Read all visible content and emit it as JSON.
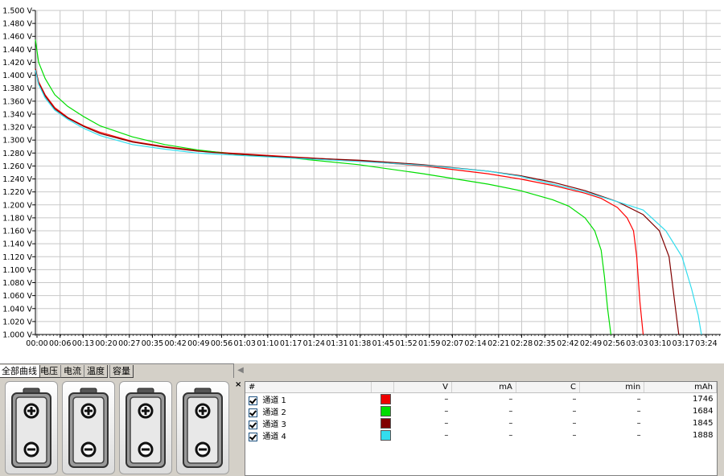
{
  "chart_data": {
    "type": "line",
    "y_unit": "V",
    "ylim": [
      1.0,
      1.5
    ],
    "y_ticks": [
      "1.500 V",
      "1.480 V",
      "1.460 V",
      "1.440 V",
      "1.420 V",
      "1.400 V",
      "1.380 V",
      "1.360 V",
      "1.340 V",
      "1.320 V",
      "1.300 V",
      "1.280 V",
      "1.260 V",
      "1.240 V",
      "1.220 V",
      "1.200 V",
      "1.180 V",
      "1.160 V",
      "1.140 V",
      "1.120 V",
      "1.100 V",
      "1.080 V",
      "1.060 V",
      "1.040 V",
      "1.020 V",
      "1.000 V"
    ],
    "x_ticks": [
      "00:00",
      "00:06",
      "00:13",
      "00:20",
      "00:27",
      "00:35",
      "00:42",
      "00:49",
      "00:56",
      "01:03",
      "01:10",
      "01:17",
      "01:24",
      "01:31",
      "01:38",
      "01:45",
      "01:52",
      "01:59",
      "02:07",
      "02:14",
      "02:21",
      "02:28",
      "02:35",
      "02:42",
      "02:49",
      "02:56",
      "03:03",
      "03:10",
      "03:17",
      "03:24"
    ],
    "x_unit": "minutes",
    "xlim": [
      0,
      212
    ],
    "grid": true,
    "series": [
      {
        "name": "通道 1",
        "color": "#ff0000",
        "x": [
          0,
          1,
          3,
          6,
          10,
          15,
          20,
          30,
          40,
          50,
          60,
          80,
          100,
          120,
          140,
          150,
          160,
          170,
          175,
          180,
          183,
          185,
          186,
          187,
          188
        ],
        "y": [
          1.41,
          1.39,
          1.37,
          1.35,
          1.335,
          1.322,
          1.312,
          1.298,
          1.29,
          1.284,
          1.28,
          1.274,
          1.268,
          1.26,
          1.248,
          1.24,
          1.23,
          1.218,
          1.21,
          1.196,
          1.18,
          1.16,
          1.12,
          1.05,
          1.0
        ]
      },
      {
        "name": "通道 2",
        "color": "#00dd00",
        "x": [
          0,
          1,
          3,
          6,
          10,
          15,
          20,
          30,
          40,
          50,
          60,
          80,
          100,
          120,
          140,
          150,
          160,
          165,
          170,
          173,
          175,
          176,
          177,
          178
        ],
        "y": [
          1.455,
          1.42,
          1.395,
          1.37,
          1.352,
          1.336,
          1.322,
          1.305,
          1.293,
          1.285,
          1.279,
          1.272,
          1.262,
          1.248,
          1.232,
          1.222,
          1.208,
          1.198,
          1.18,
          1.16,
          1.13,
          1.09,
          1.04,
          1.0
        ]
      },
      {
        "name": "通道 3",
        "color": "#800000",
        "x": [
          0,
          1,
          3,
          6,
          10,
          15,
          20,
          30,
          40,
          50,
          60,
          80,
          100,
          120,
          140,
          150,
          160,
          170,
          180,
          188,
          193,
          196,
          197,
          198,
          199
        ],
        "y": [
          1.41,
          1.388,
          1.368,
          1.348,
          1.334,
          1.321,
          1.31,
          1.297,
          1.289,
          1.283,
          1.279,
          1.273,
          1.269,
          1.262,
          1.252,
          1.245,
          1.235,
          1.222,
          1.205,
          1.185,
          1.16,
          1.12,
          1.08,
          1.04,
          1.0
        ]
      },
      {
        "name": "通道 4",
        "color": "#33ddee",
        "x": [
          0,
          1,
          3,
          6,
          10,
          15,
          20,
          30,
          40,
          50,
          60,
          80,
          100,
          120,
          140,
          150,
          160,
          170,
          180,
          188,
          195,
          200,
          203,
          205,
          206
        ],
        "y": [
          1.408,
          1.386,
          1.365,
          1.346,
          1.332,
          1.318,
          1.307,
          1.293,
          1.286,
          1.28,
          1.277,
          1.272,
          1.267,
          1.261,
          1.252,
          1.244,
          1.232,
          1.22,
          1.205,
          1.192,
          1.16,
          1.12,
          1.07,
          1.03,
          1.0
        ]
      }
    ]
  },
  "tabs": [
    {
      "label": "全部曲线",
      "active": true
    },
    {
      "label": "电压",
      "active": false
    },
    {
      "label": "电流",
      "active": false
    },
    {
      "label": "温度",
      "active": false
    },
    {
      "label": "容量",
      "active": false
    }
  ],
  "scroll_left_glyph": "◀",
  "close_glyph": "×",
  "batteries": [
    {
      "icon": "battery-icon"
    },
    {
      "icon": "battery-icon"
    },
    {
      "icon": "battery-icon"
    },
    {
      "icon": "battery-icon"
    }
  ],
  "table": {
    "headers": [
      "#",
      "",
      "V",
      "mA",
      "C",
      "min",
      "mAh"
    ],
    "rows": [
      {
        "name": "通道  1",
        "color": "#ee0000",
        "V": "–",
        "mA": "–",
        "C": "–",
        "min": "–",
        "mAh": "1746"
      },
      {
        "name": "通道  2",
        "color": "#00dd00",
        "V": "–",
        "mA": "–",
        "C": "–",
        "min": "–",
        "mAh": "1684"
      },
      {
        "name": "通道  3",
        "color": "#800000",
        "V": "–",
        "mA": "–",
        "C": "–",
        "min": "–",
        "mAh": "1845"
      },
      {
        "name": "通道  4",
        "color": "#33ddee",
        "V": "–",
        "mA": "–",
        "C": "–",
        "min": "–",
        "mAh": "1888"
      }
    ]
  }
}
